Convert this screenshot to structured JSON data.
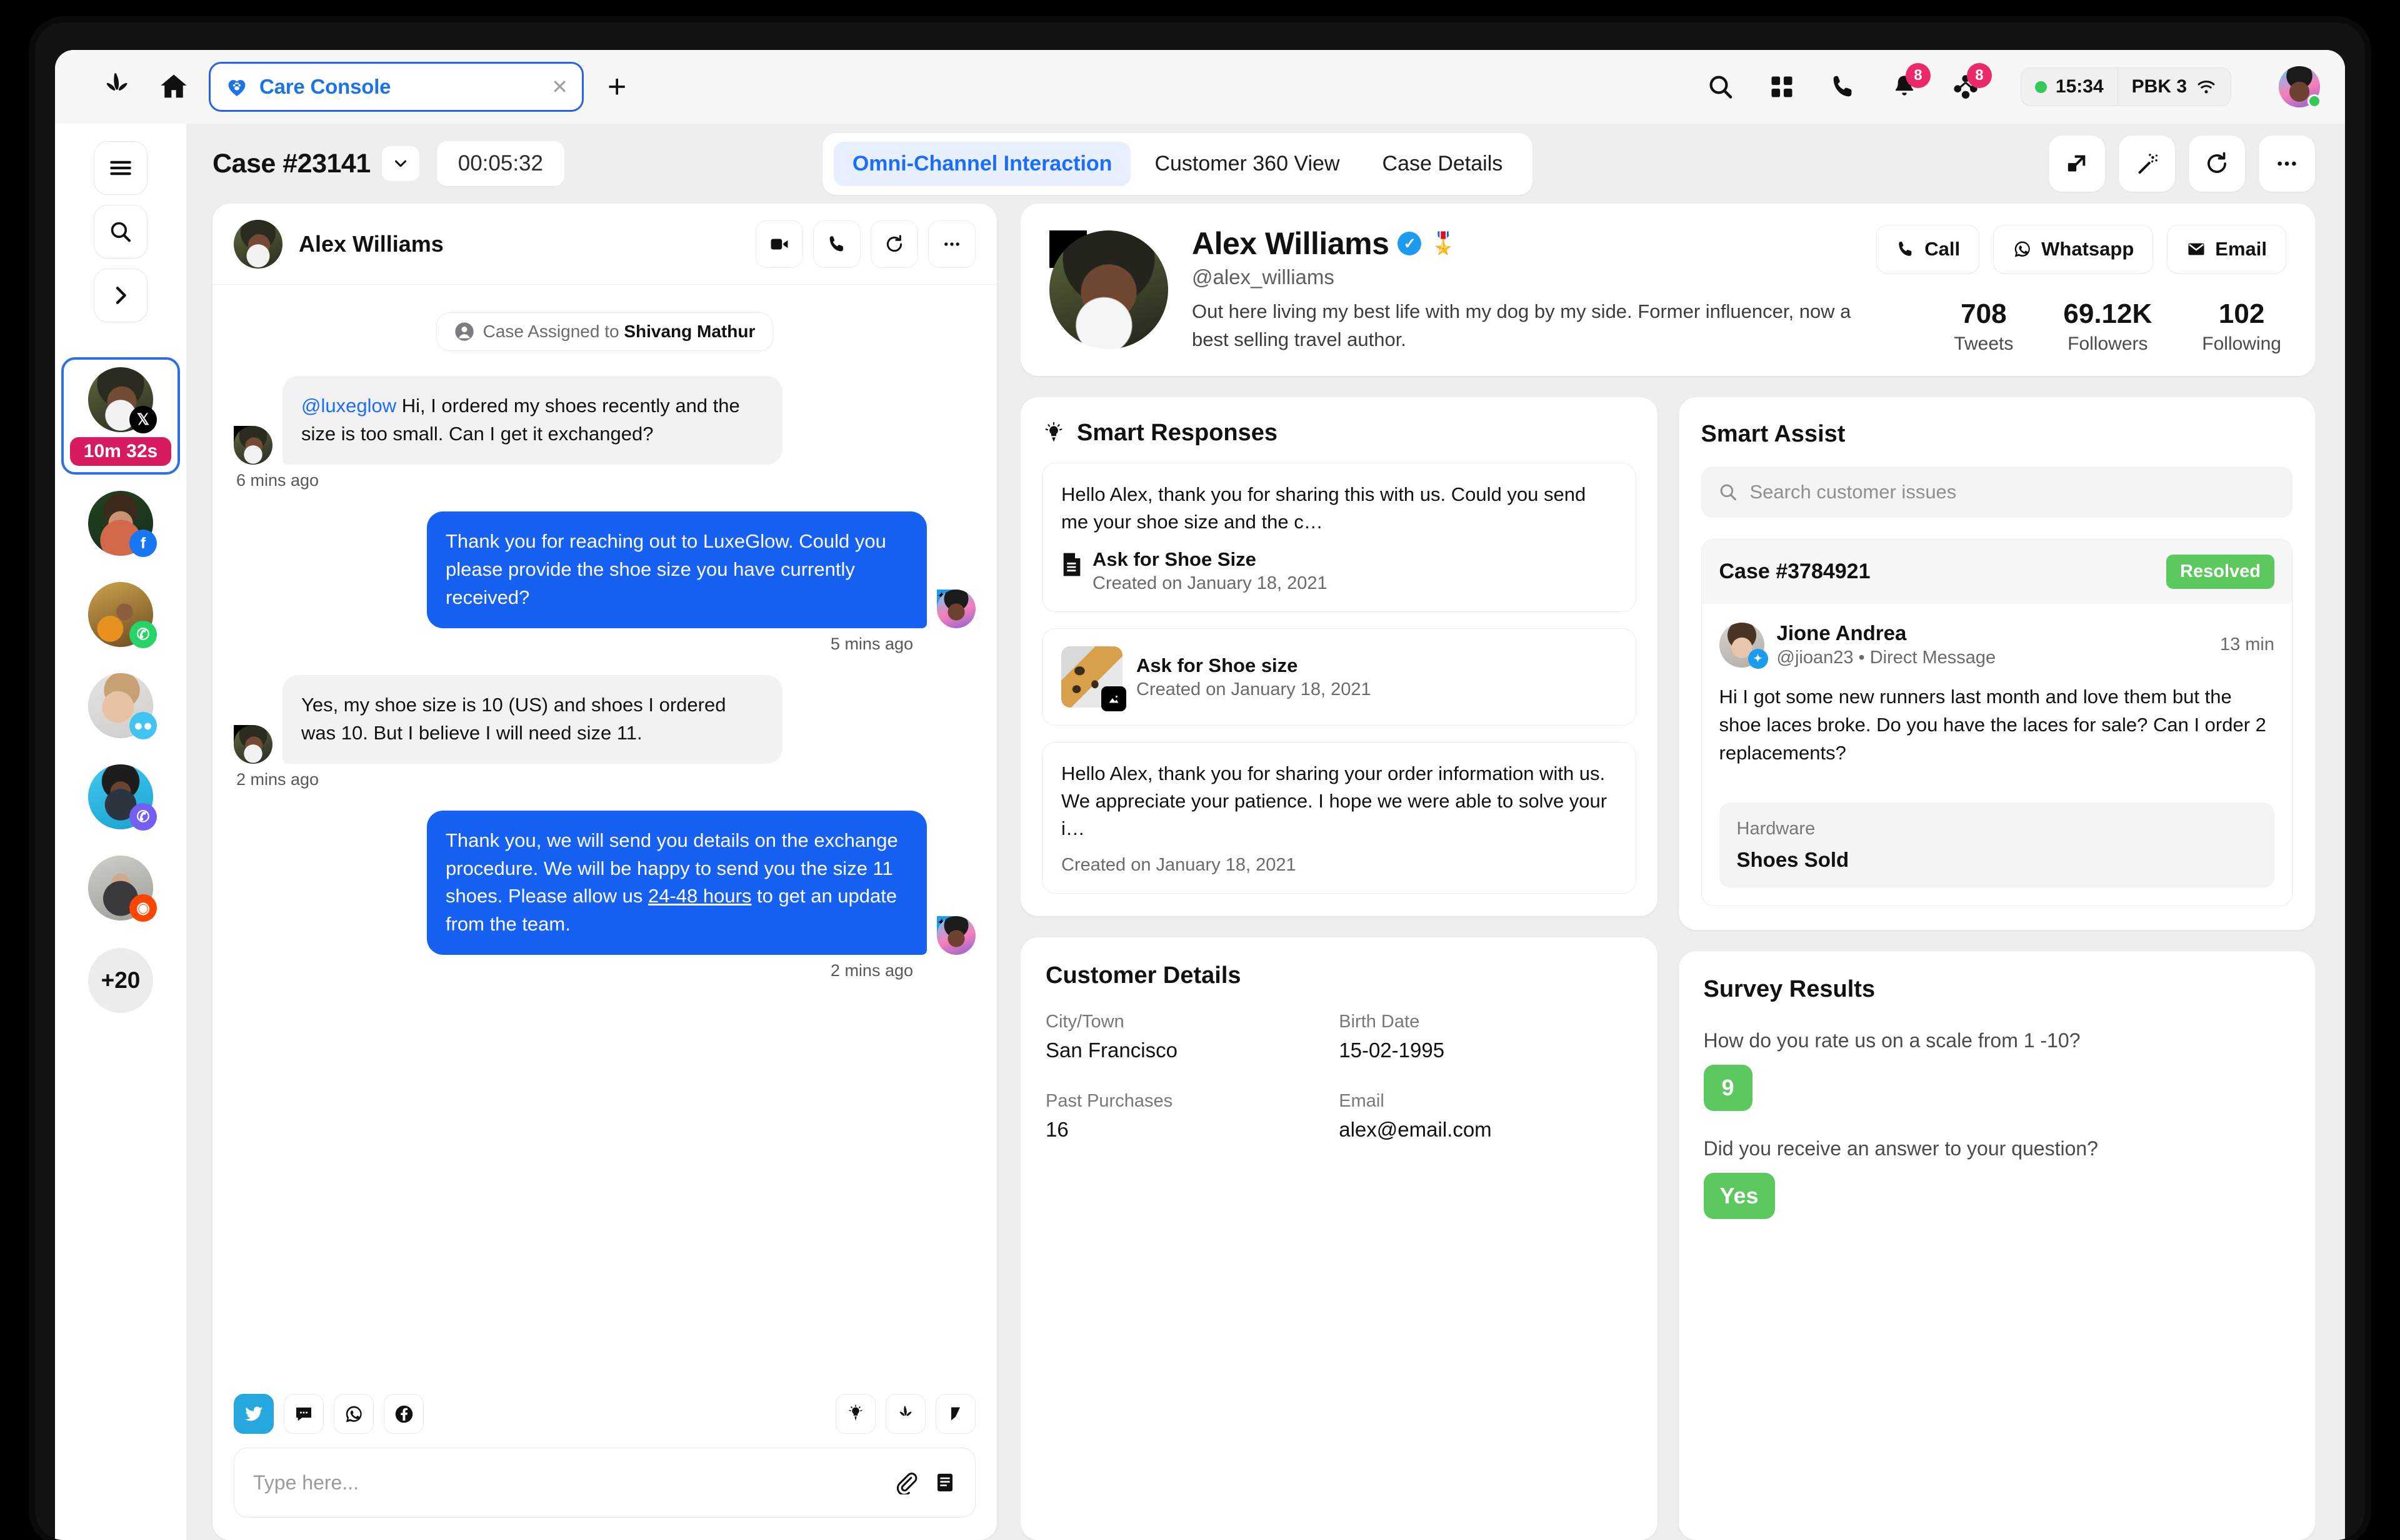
{
  "browser": {
    "logo_icon": "sprinklr-logo-icon",
    "home_icon": "home-icon",
    "tab": {
      "title": "Care Console",
      "favicon": "care-heart-icon",
      "close": "✕"
    },
    "new_tab": "+",
    "icons": [
      "search-icon",
      "apps-grid-icon",
      "phone-icon",
      "bell-icon",
      "people-icon"
    ],
    "notification_badge": "8",
    "people_badge": "8",
    "status": {
      "time": "15:34",
      "label": "PBK 3",
      "wifi_icon": "wifi-icon",
      "presence": "online"
    }
  },
  "rail": {
    "buttons": [
      "menu-icon",
      "search-icon",
      "chevron-right-icon"
    ],
    "conversations": [
      {
        "channel": "x",
        "timer": "10m 32s",
        "active": true
      },
      {
        "channel": "fb",
        "active": false
      },
      {
        "channel": "wa",
        "active": false
      },
      {
        "channel": "msg",
        "active": false
      },
      {
        "channel": "vb",
        "active": false
      },
      {
        "channel": "rd",
        "active": false
      }
    ],
    "more_count": "+20"
  },
  "case_header": {
    "case_id": "Case #23141",
    "timer": "00:05:32",
    "tabs": [
      {
        "label": "Omni-Channel Interaction",
        "active": true
      },
      {
        "label": "Customer 360 View",
        "active": false
      },
      {
        "label": "Case Details",
        "active": false
      }
    ],
    "actions": [
      "transfer-icon",
      "magic-wand-icon",
      "refresh-icon",
      "more-options-icon"
    ]
  },
  "chat": {
    "contact_name": "Alex Williams",
    "head_actions": [
      "video-call-icon",
      "phone-call-icon",
      "refresh-icon",
      "more-options-icon"
    ],
    "assigned_prefix": "Case Assigned to ",
    "assigned_agent": "Shivang Mathur",
    "messages": [
      {
        "dir": "in",
        "mention": "@luxeglow",
        "text": " Hi, I ordered my shoes recently and the size is too small. Can I get it exchanged?",
        "time": "6 mins ago",
        "channel": "x"
      },
      {
        "dir": "out",
        "text": "Thank you for reaching out to LuxeGlow. Could you please provide the shoe size you have currently received?",
        "time": "5 mins ago",
        "channel": "tw"
      },
      {
        "dir": "in",
        "text": "Yes, my shoe size is 10 (US) and shoes I ordered was 10. But I believe I will need size 11.",
        "time": "2 mins ago",
        "channel": "x"
      },
      {
        "dir": "out",
        "text_pre": "Thank you, we will send you details on the exchange procedure. We will be happy to send you the size 11 shoes. Please allow us ",
        "text_underline": "24-48 hours",
        "text_post": " to get an update from the team.",
        "time": "2 mins ago",
        "channel": "tw"
      }
    ],
    "channels": [
      {
        "name": "twitter-icon",
        "selected": true
      },
      {
        "name": "sms-icon",
        "selected": false
      },
      {
        "name": "whatsapp-icon",
        "selected": false
      },
      {
        "name": "facebook-icon",
        "selected": false
      }
    ],
    "assist_icons": [
      "lightbulb-pen-icon",
      "sprinklr-icon",
      "knowledge-icon"
    ],
    "input_placeholder": "Type here...",
    "input_value": "",
    "input_icons": [
      "attachment-icon",
      "template-icon"
    ]
  },
  "profile": {
    "name": "Alex Williams",
    "verified_icon": "verified-badge-icon",
    "vip_icon": "🎖️",
    "handle": "@alex_williams",
    "bio": "Out here living my best life with my dog by my side. Former influencer, now a best selling travel author.",
    "channel": "x",
    "actions": [
      {
        "label": "Call",
        "icon": "phone-icon"
      },
      {
        "label": "Whatsapp",
        "icon": "whatsapp-icon"
      },
      {
        "label": "Email",
        "icon": "email-icon"
      }
    ],
    "stats": [
      {
        "value": "708",
        "label": "Tweets"
      },
      {
        "value": "69.12K",
        "label": "Followers"
      },
      {
        "value": "102",
        "label": "Following"
      }
    ]
  },
  "smart_responses": {
    "title": "Smart Responses",
    "icon": "lightbulb-icon",
    "items": [
      {
        "preview": "Hello Alex, thank you for sharing this with us. Could you send me your shoe size and the c…",
        "title": "Ask for Shoe Size",
        "date": "Created on January 18, 2021",
        "media": "document"
      },
      {
        "preview": "",
        "title": "Ask for Shoe size",
        "date": "Created on January 18, 2021",
        "media": "image"
      },
      {
        "preview": "Hello Alex, thank you for sharing your order information with us. We appreciate your patience. I hope we were able to solve your i…",
        "title": "",
        "date": "Created on January 18, 2021",
        "media": "none"
      }
    ]
  },
  "customer_details": {
    "title": "Customer Details",
    "fields": [
      {
        "label": "City/Town",
        "value": "San Francisco"
      },
      {
        "label": "Birth Date",
        "value": "15-02-1995"
      },
      {
        "label": "Past Purchases",
        "value": "16"
      },
      {
        "label": "Email",
        "value": "alex@email.com"
      }
    ]
  },
  "smart_assist": {
    "title": "Smart Assist",
    "search_placeholder": "Search customer issues",
    "case": {
      "id": "Case #3784921",
      "status": "Resolved",
      "status_color": "#5cc95f",
      "person_name": "Jione Andrea",
      "person_handle": "@jioan23 • Direct Message",
      "time": "13 min",
      "message": "Hi I got some new runners last month and love them but the shoe laces broke. Do you have the laces for sale? Can I order 2 replacements?",
      "tag_label": "Hardware",
      "tag_value": "Shoes Sold"
    }
  },
  "survey": {
    "title": "Survey Results",
    "questions": [
      {
        "q": "How do you rate us on a scale from 1 -10?",
        "a": "9"
      },
      {
        "q": "Did you receive an answer to your question?",
        "a": "Yes"
      }
    ]
  }
}
